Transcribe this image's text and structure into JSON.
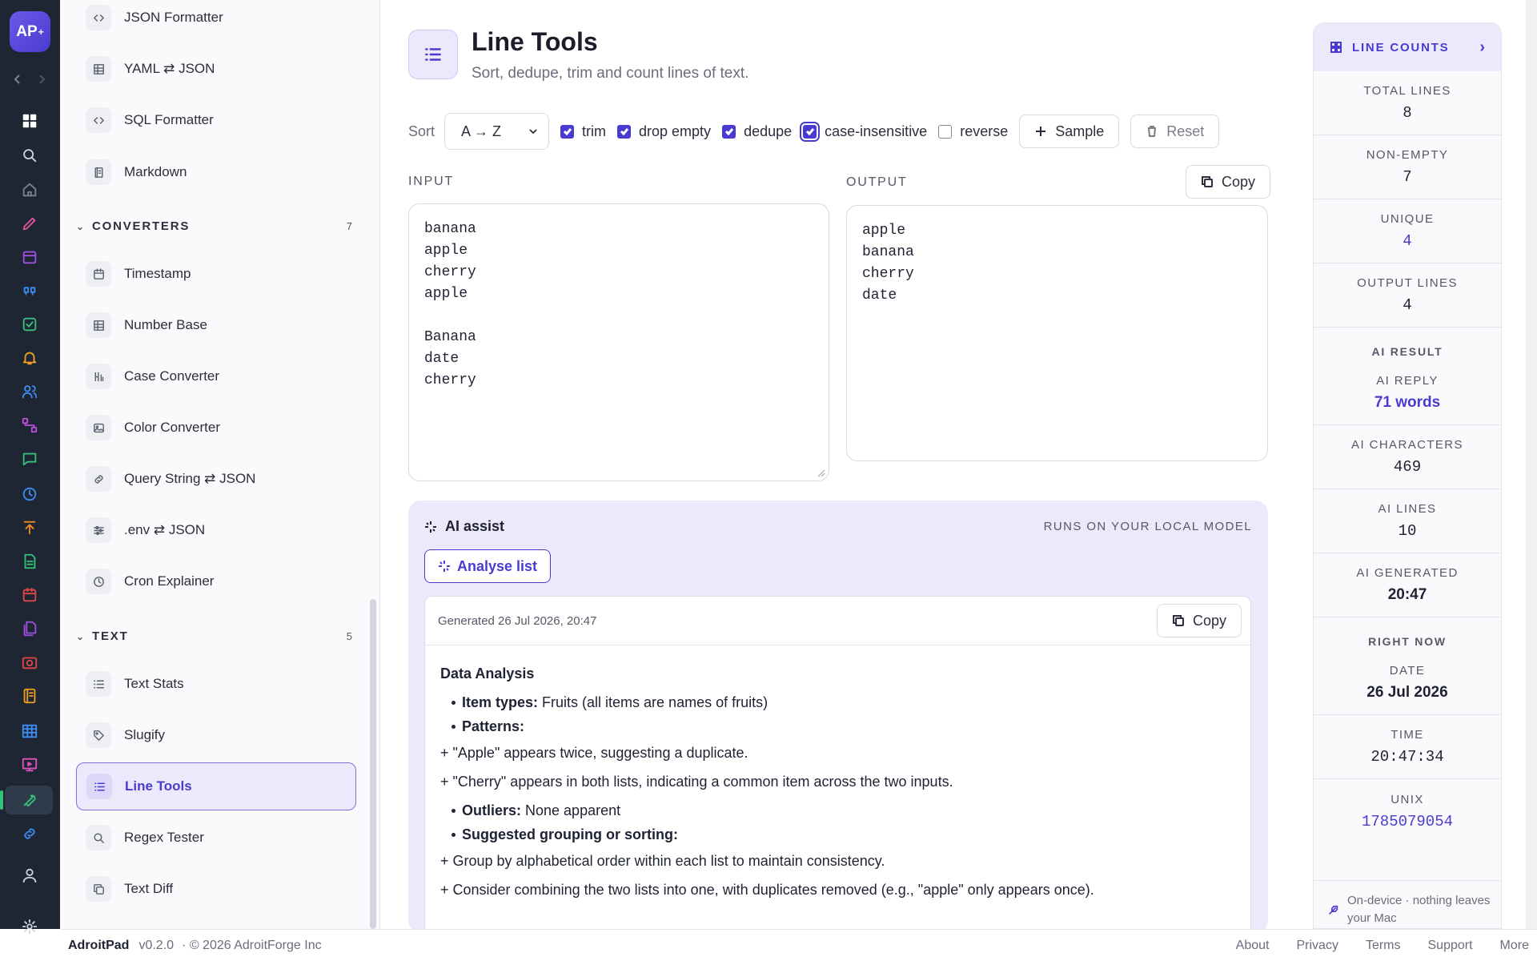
{
  "app": {
    "logo": "AP",
    "name": "AdroitPad",
    "version": "v0.2.0",
    "copyright": "· © 2026 AdroitForge Inc"
  },
  "sidebar": {
    "top_items": [
      {
        "label": "JSON Formatter",
        "icon": "code-icon"
      },
      {
        "label": "YAML ⇄ JSON",
        "icon": "table-icon"
      },
      {
        "label": "SQL Formatter",
        "icon": "code-icon"
      },
      {
        "label": "Markdown",
        "icon": "document-icon"
      }
    ],
    "converters": {
      "title": "CONVERTERS",
      "count": "7",
      "items": [
        {
          "label": "Timestamp",
          "icon": "calendar-icon"
        },
        {
          "label": "Number Base",
          "icon": "table-icon"
        },
        {
          "label": "Case Converter",
          "icon": "case-icon"
        },
        {
          "label": "Color Converter",
          "icon": "image-icon"
        },
        {
          "label": "Query String ⇄ JSON",
          "icon": "link-icon"
        },
        {
          "label": ".env ⇄ JSON",
          "icon": "sliders-icon"
        },
        {
          "label": "Cron Explainer",
          "icon": "clock-icon"
        }
      ]
    },
    "text": {
      "title": "TEXT",
      "count": "5",
      "items": [
        {
          "label": "Text Stats",
          "icon": "list-icon"
        },
        {
          "label": "Slugify",
          "icon": "tag-icon"
        },
        {
          "label": "Line Tools",
          "icon": "list-icon",
          "active": true
        },
        {
          "label": "Regex Tester",
          "icon": "search-icon"
        },
        {
          "label": "Text Diff",
          "icon": "copy-icon"
        }
      ]
    }
  },
  "header": {
    "title": "Line Tools",
    "subtitle": "Sort, dedupe, trim and count lines of text."
  },
  "toolbar": {
    "sort_label": "Sort",
    "sort_value": "A → Z",
    "options": [
      {
        "label": "trim",
        "checked": true
      },
      {
        "label": "drop empty",
        "checked": true
      },
      {
        "label": "dedupe",
        "checked": true
      },
      {
        "label": "case-insensitive",
        "checked": true
      },
      {
        "label": "reverse",
        "checked": false
      }
    ],
    "sample_label": "Sample",
    "reset_label": "Reset"
  },
  "input": {
    "label": "INPUT",
    "value": "banana\napple\ncherry\napple\n\nBanana\ndate\ncherry"
  },
  "output": {
    "label": "OUTPUT",
    "copy_label": "Copy",
    "value": "apple\nbanana\ncherry\ndate"
  },
  "ai": {
    "title": "AI assist",
    "tag": "RUNS ON YOUR LOCAL MODEL",
    "analyse_label": "Analyse list",
    "generated": "Generated 26 Jul 2026, 20:47",
    "copy_label": "Copy",
    "heading": "Data Analysis",
    "item_types_key": "Item types:",
    "item_types_val": " Fruits (all items are names of fruits)",
    "patterns_key": "Patterns:",
    "p1": "+ \"Apple\" appears twice, suggesting a duplicate.",
    "p2": "+ \"Cherry\" appears in both lists, indicating a common item across the two inputs.",
    "outliers_key": "Outliers:",
    "outliers_val": " None apparent",
    "grouping_key": "Suggested grouping or sorting:",
    "p3": "+ Group by alphabetical order within each list to maintain consistency.",
    "p4": "+ Consider combining the two lists into one, with duplicates removed (e.g., \"apple\" only appears once)."
  },
  "panel": {
    "title": "LINE COUNTS",
    "total_lines_k": "TOTAL LINES",
    "total_lines_v": "8",
    "non_empty_k": "NON-EMPTY",
    "non_empty_v": "7",
    "unique_k": "UNIQUE",
    "unique_v": "4",
    "output_lines_k": "OUTPUT LINES",
    "output_lines_v": "4",
    "ai_result": "AI RESULT",
    "ai_reply_k": "AI REPLY",
    "ai_reply_v": "71 words",
    "ai_chars_k": "AI CHARACTERS",
    "ai_chars_v": "469",
    "ai_lines_k": "AI LINES",
    "ai_lines_v": "10",
    "ai_generated_k": "AI GENERATED",
    "ai_generated_v": "20:47",
    "right_now": "RIGHT NOW",
    "date_k": "DATE",
    "date_v": "26 Jul 2026",
    "time_k": "TIME",
    "time_v": "20:47:34",
    "unix_k": "UNIX",
    "unix_v": "1785079054",
    "footer": "On-device · nothing leaves your Mac"
  },
  "footer_links": [
    "About",
    "Privacy",
    "Terms",
    "Support",
    "More"
  ],
  "colors": {
    "accent": "#4a3bd0",
    "accent_bg": "#ebe9fb",
    "rail": "#1e2533"
  }
}
